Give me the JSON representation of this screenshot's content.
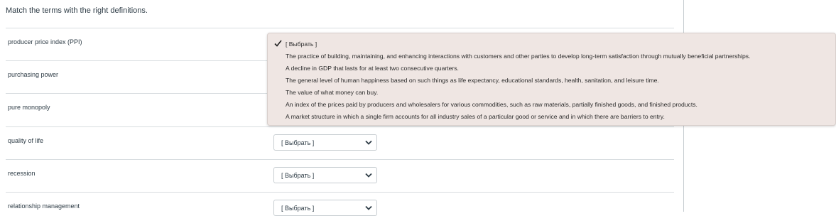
{
  "instruction": "Match the terms with the right definitions.",
  "rows": [
    {
      "term": "producer price index (PPI)",
      "selected": "[ Выбрать ]"
    },
    {
      "term": "purchasing power",
      "selected": "[ Выбрать ]"
    },
    {
      "term": "pure monopoly",
      "selected": "[ Выбрать ]"
    },
    {
      "term": "quality of life",
      "selected": "[ Выбрать ]"
    },
    {
      "term": "recession",
      "selected": "[ Выбрать ]"
    },
    {
      "term": "relationship management",
      "selected": "[ Выбрать ]"
    }
  ],
  "dropdown": {
    "options": [
      "[ Выбрать ]",
      "The practice of building, maintaining, and enhancing interactions with customers and other parties to develop long-term satisfaction through mutually beneficial partnerships.",
      "A decline in GDP that lasts for at least two consecutive quarters.",
      "The general level of human happiness based on such things as life expectancy, educational standards, health, sanitation, and leisure time.",
      "The value of what money can buy.",
      "An index of the prices paid by producers and wholesalers for various commodities, such as raw materials, partially finished goods, and finished products.",
      "A market structure in which a single firm accounts for all industry sales of a particular good or service and in which there are barriers to entry."
    ],
    "checked_option": "[ Выбрать ]"
  },
  "icons": {
    "checkmark": "check-icon",
    "select_arrow": "chevron-down-icon"
  },
  "colors": {
    "dropdown_bg": "#efe6e3",
    "text": "#2d3b45",
    "divider": "#d8dde0"
  }
}
